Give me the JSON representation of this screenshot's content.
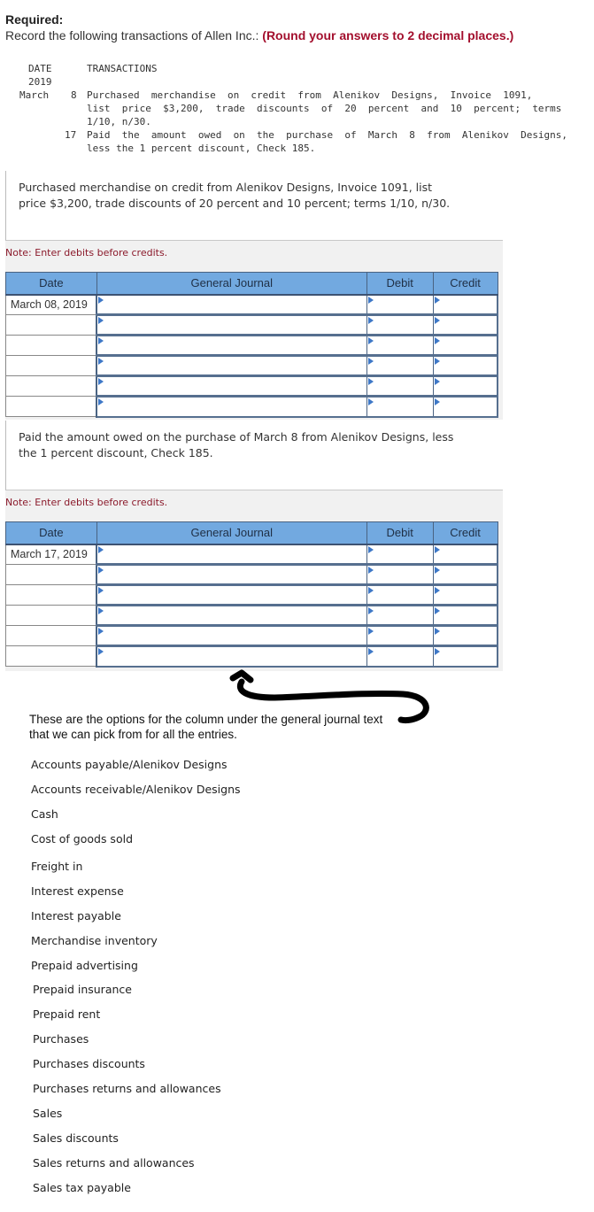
{
  "header": {
    "required_label": "Required:",
    "instruction": "Record the following transactions of Allen Inc.:",
    "rounding_note": "(Round your answers to 2 decimal places.)"
  },
  "transactions": {
    "col_date": "DATE",
    "col_transactions": "TRANSACTIONS",
    "year": "2019",
    "month": "March",
    "entries": [
      {
        "day": "8",
        "lines": [
          "Purchased  merchandise  on  credit  from  Alenikov  Designs,  Invoice  1091,",
          "list  price  $3,200,  trade  discounts  of  20  percent  and  10  percent;  terms",
          "1/10, n/30."
        ]
      },
      {
        "day": "17",
        "lines": [
          "Paid  the  amount  owed  on  the  purchase  of  March  8  from  Alenikov  Designs,",
          "less the 1 percent discount, Check 185."
        ]
      }
    ]
  },
  "journal_sections": [
    {
      "prompt_lines": [
        "Purchased merchandise on credit from Alenikov Designs, Invoice 1091, list",
        "price $3,200, trade discounts of 20 percent and 10 percent; terms 1/10, n/30."
      ],
      "note": "Note: Enter debits before credits.",
      "headers": {
        "date": "Date",
        "journal": "General Journal",
        "debit": "Debit",
        "credit": "Credit"
      },
      "rows": [
        {
          "date": "March 08, 2019",
          "account": "",
          "debit": "",
          "credit": ""
        },
        {
          "date": "",
          "account": "",
          "debit": "",
          "credit": ""
        },
        {
          "date": "",
          "account": "",
          "debit": "",
          "credit": ""
        },
        {
          "date": "",
          "account": "",
          "debit": "",
          "credit": ""
        },
        {
          "date": "",
          "account": "",
          "debit": "",
          "credit": ""
        },
        {
          "date": "",
          "account": "",
          "debit": "",
          "credit": ""
        }
      ]
    },
    {
      "prompt_lines": [
        "Paid the amount owed on the purchase of March 8 from Alenikov Designs, less",
        "the 1 percent discount, Check 185."
      ],
      "note": "Note: Enter debits before credits.",
      "headers": {
        "date": "Date",
        "journal": "General Journal",
        "debit": "Debit",
        "credit": "Credit"
      },
      "rows": [
        {
          "date": "March 17, 2019",
          "account": "",
          "debit": "",
          "credit": ""
        },
        {
          "date": "",
          "account": "",
          "debit": "",
          "credit": ""
        },
        {
          "date": "",
          "account": "",
          "debit": "",
          "credit": ""
        },
        {
          "date": "",
          "account": "",
          "debit": "",
          "credit": ""
        },
        {
          "date": "",
          "account": "",
          "debit": "",
          "credit": ""
        },
        {
          "date": "",
          "account": "",
          "debit": "",
          "credit": ""
        }
      ]
    }
  ],
  "annotation": {
    "text_line1": "These are the options for the column under the general journal text",
    "text_line2": "that we can pick from for all the entries."
  },
  "account_options": [
    "Accounts payable/Alenikov Designs",
    "Accounts receivable/Alenikov Designs",
    "Cash",
    "Cost of goods sold",
    "Freight in",
    "Interest expense",
    "Interest payable",
    "Merchandise inventory",
    "Prepaid advertising",
    "Prepaid insurance",
    "Prepaid rent",
    "Purchases",
    "Purchases discounts",
    "Purchases returns and allowances",
    "Sales",
    "Sales discounts",
    "Sales returns and allowances",
    "Sales tax payable"
  ],
  "colors": {
    "accent_red": "#a30f2d",
    "note_red": "#8b1a2b",
    "header_blue": "#72a9e0",
    "border_navy": "#4a6382"
  }
}
